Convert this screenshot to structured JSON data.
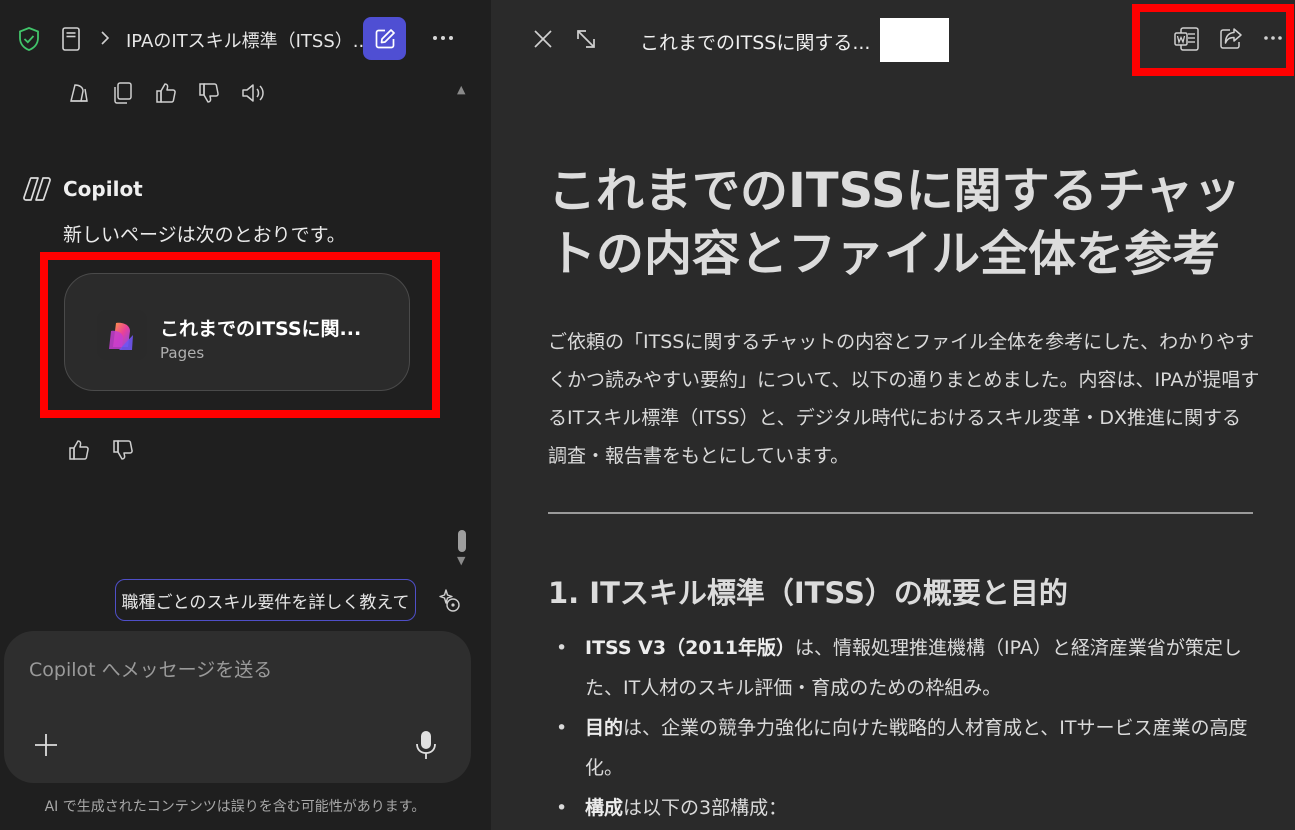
{
  "left_header": {
    "breadcrumb": "IPAのITスキル標準（ITSS）..."
  },
  "copilot": {
    "name": "Copilot",
    "message": "新しいページは次のとおりです。"
  },
  "page_card": {
    "title": "これまでのITSSに関...",
    "subtitle": "Pages"
  },
  "suggestion": "職種ごとのスキル要件を詳しく教えて",
  "composer": {
    "placeholder": "Copilot へメッセージを送る"
  },
  "disclaimer": "AI で生成されたコンテンツは誤りを含む可能性があります。",
  "right_header": {
    "title": "これまでのITSSに関する..."
  },
  "document": {
    "heading": "これまでのITSSに関するチャットの内容とファイル全体を参考",
    "intro": "ご依頼の「ITSSに関するチャットの内容とファイル全体を参考にした、わかりやすくかつ読みやすい要約」について、以下の通りまとめました。内容は、IPAが提唱するITスキル標準（ITSS）と、デジタル時代におけるスキル変革・DX推進に関する調査・報告書をもとにしています。",
    "section1_title": "1. ITスキル標準（ITSS）の概要と目的",
    "bullets": [
      {
        "bold": "ITSS V3（2011年版）",
        "text": "は、情報処理推進機構（IPA）と経済産業省が策定した、IT人材のスキル評価・育成のための枠組み。"
      },
      {
        "bold": "目的",
        "text": "は、企業の競争力強化に向けた戦略的人材育成と、ITサービス産業の高度化。"
      },
      {
        "bold": "構成",
        "text": "は以下の3部構成："
      }
    ]
  },
  "colors": {
    "accent": "#4f4fd3",
    "highlight": "#ff0000",
    "left_bg": "#1f1f1f",
    "right_bg": "#2a2a2a"
  }
}
